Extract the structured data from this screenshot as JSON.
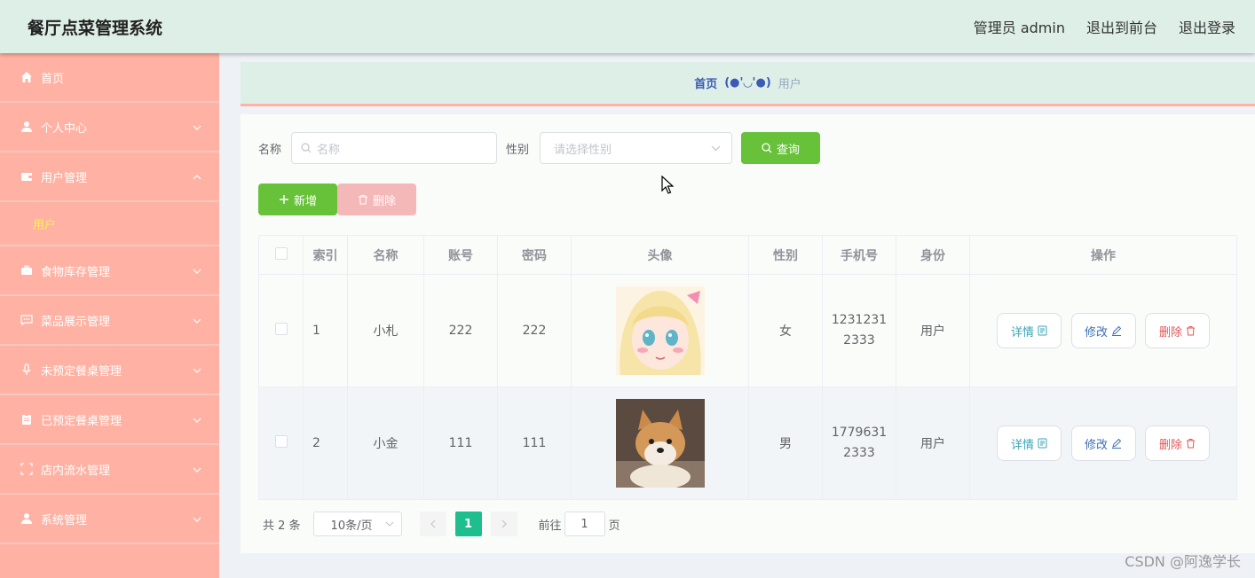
{
  "header": {
    "title": "餐厅点菜管理系统",
    "admin_label": "管理员 admin",
    "front_label": "退出到前台",
    "logout_label": "退出登录"
  },
  "sidebar": {
    "items": [
      {
        "label": "首页",
        "icon": "home-icon"
      },
      {
        "label": "个人中心",
        "icon": "user-icon"
      },
      {
        "label": "用户管理",
        "icon": "wallet-icon",
        "expanded": true,
        "children": [
          {
            "label": "用户"
          }
        ]
      },
      {
        "label": "食物库存管理",
        "icon": "briefcase-icon"
      },
      {
        "label": "菜品展示管理",
        "icon": "chat-icon"
      },
      {
        "label": "未预定餐桌管理",
        "icon": "microphone-icon"
      },
      {
        "label": "已预定餐桌管理",
        "icon": "clipboard-icon"
      },
      {
        "label": "店内流水管理",
        "icon": "fullscreen-icon"
      },
      {
        "label": "系统管理",
        "icon": "user-icon"
      }
    ]
  },
  "breadcrumb": {
    "home": "首页",
    "face": "(●'◡'●)",
    "current": "用户"
  },
  "search": {
    "name_label": "名称",
    "name_placeholder": "名称",
    "gender_label": "性别",
    "gender_placeholder": "请选择性别",
    "query_label": "查询"
  },
  "actions": {
    "add_label": "新增",
    "delete_label": "删除"
  },
  "table": {
    "headers": [
      "索引",
      "名称",
      "账号",
      "密码",
      "头像",
      "性别",
      "手机号",
      "身份",
      "操作"
    ],
    "rows": [
      {
        "index": "1",
        "name": "小札",
        "account": "222",
        "password": "222",
        "avatar": "anime-girl-avatar",
        "gender": "女",
        "phone_1": "1231231",
        "phone_2": "2333",
        "role": "用户"
      },
      {
        "index": "2",
        "name": "小金",
        "account": "111",
        "password": "111",
        "avatar": "shiba-dog-avatar",
        "gender": "男",
        "phone_1": "1779631",
        "phone_2": "2333",
        "role": "用户"
      }
    ],
    "ops": {
      "detail": "详情",
      "edit": "修改",
      "delete": "删除"
    }
  },
  "pagination": {
    "total": "共 2 条",
    "page_size": "10条/页",
    "current_page": "1",
    "goto_prefix": "前往",
    "goto_value": "1",
    "goto_suffix": "页"
  },
  "watermark": "CSDN @阿逸学长",
  "colors": {
    "header_bg": "#deefe8",
    "sidebar_bg": "#ffb2a3",
    "active_sub": "#ffef5c",
    "primary_green": "#67c23a",
    "page_active": "#1fbe8f"
  }
}
